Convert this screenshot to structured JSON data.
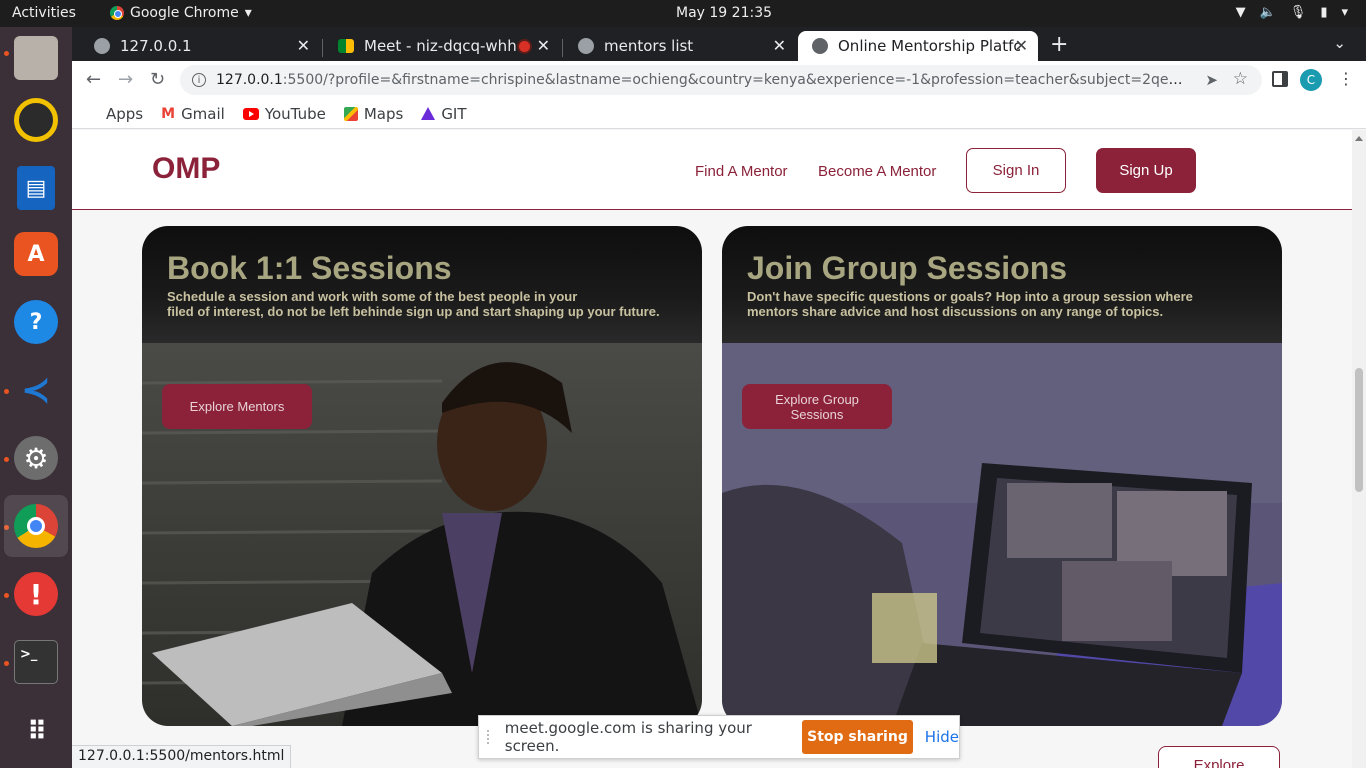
{
  "system": {
    "activities": "Activities",
    "app_name": "Google Chrome",
    "clock": "May 19  21:35"
  },
  "dock": {
    "items": [
      {
        "name": "files",
        "color": "#b7b1a9"
      },
      {
        "name": "rhythmbox",
        "color": "#f2c200"
      },
      {
        "name": "libreoffice-impress",
        "color": "#1565c0"
      },
      {
        "name": "ubuntu-software",
        "color": "#e95420"
      },
      {
        "name": "help",
        "color": "#1e88e5"
      },
      {
        "name": "vscode",
        "color": "#1f78d1"
      },
      {
        "name": "settings",
        "color": "#6d6d6d"
      },
      {
        "name": "chrome",
        "color": "#4285f4"
      },
      {
        "name": "error-reporter",
        "color": "#e53935"
      },
      {
        "name": "terminal",
        "color": "#333333"
      },
      {
        "name": "show-apps",
        "color": "#ffffff"
      }
    ]
  },
  "tabs": [
    {
      "label": "127.0.0.1"
    },
    {
      "label": "Meet - niz-dqcq-whh"
    },
    {
      "label": "mentors list"
    },
    {
      "label": "Online Mentorship Platfo"
    }
  ],
  "toolbar": {
    "url_host": "127.0.0.1",
    "url_rest": ":5500/?profile=&firstname=chrispine&lastname=ochieng&country=kenya&experience=-1&profession=teacher&subject=2qewftrgwerctyuoimp...",
    "profile_initial": "C"
  },
  "bookmarks": [
    {
      "label": "Apps"
    },
    {
      "label": "Gmail"
    },
    {
      "label": "YouTube"
    },
    {
      "label": "Maps"
    },
    {
      "label": "GIT"
    }
  ],
  "site": {
    "logo": "OMP",
    "nav": {
      "find_mentor": "Find A Mentor",
      "become_mentor": "Become A Mentor",
      "sign_in": "Sign In",
      "sign_up": "Sign Up"
    },
    "brand_color": "#8b2239",
    "cards": [
      {
        "title": "Book 1:1 Sessions",
        "desc_line1": "Schedule a session and work with some of the best people in your",
        "desc_line2": "filed of interest, do not be left behinde sign up and start shaping up your future.",
        "cta": "Explore Mentors"
      },
      {
        "title": "Join Group Sessions",
        "desc_line1": "Don't have specific questions or goals? Hop into a group session where",
        "desc_line2": "mentors share advice and host discussions on any range of topics.",
        "cta": "Explore Group Sessions"
      }
    ],
    "explore_partial": "Explore"
  },
  "share_bar": {
    "message": "meet.google.com is sharing your screen.",
    "stop": "Stop sharing",
    "hide": "Hide"
  },
  "status_url": "127.0.0.1:5500/mentors.html"
}
